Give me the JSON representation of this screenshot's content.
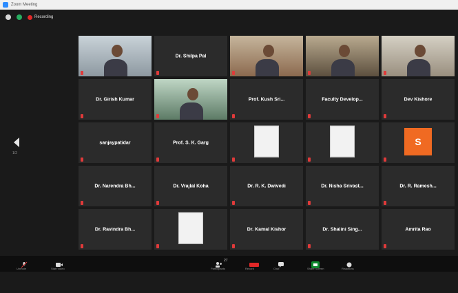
{
  "window": {
    "title": "Zoom Meeting"
  },
  "top_bar": {
    "recording_label": "Recording"
  },
  "side_nav": {
    "page_label": "1/2"
  },
  "participants": [
    {
      "type": "video",
      "name": "",
      "label": ""
    },
    {
      "type": "name",
      "name": "Dr. Shilpa Pal",
      "label": ""
    },
    {
      "type": "video",
      "name": "",
      "label": ""
    },
    {
      "type": "video",
      "name": "",
      "label": ""
    },
    {
      "type": "video",
      "name": "",
      "label": ""
    },
    {
      "type": "name",
      "name": "Dr. Girish Kumar",
      "label": ""
    },
    {
      "type": "video",
      "name": "",
      "label": "",
      "active": true
    },
    {
      "type": "name",
      "name": "Prof. Kush Sri...",
      "label": ""
    },
    {
      "type": "name",
      "name": "Faculty Develop...",
      "label": ""
    },
    {
      "type": "name",
      "name": "Dev Kishore",
      "label": ""
    },
    {
      "type": "name",
      "name": "sanjaypatidar",
      "label": ""
    },
    {
      "type": "name",
      "name": "Prof. S. K. Garg",
      "label": ""
    },
    {
      "type": "picture",
      "name": "",
      "label": ""
    },
    {
      "type": "picture",
      "name": "",
      "label": ""
    },
    {
      "type": "avatar",
      "name": "",
      "label": "",
      "avatar_letter": "S"
    },
    {
      "type": "name",
      "name": "Dr. Narendra Bh...",
      "label": ""
    },
    {
      "type": "name",
      "name": "Dr. Vrajlal Koha",
      "label": ""
    },
    {
      "type": "name",
      "name": "Dr. R. K. Dwivedi",
      "label": ""
    },
    {
      "type": "name",
      "name": "Dr. Nisha Srivast...",
      "label": ""
    },
    {
      "type": "name",
      "name": "Dr. R. Ramesh...",
      "label": ""
    },
    {
      "type": "name",
      "name": "Dr. Ravindra Bh...",
      "label": ""
    },
    {
      "type": "picture",
      "name": "",
      "label": ""
    },
    {
      "type": "name",
      "name": "Dr. Kamal Kishor",
      "label": ""
    },
    {
      "type": "name",
      "name": "Dr. Shalini Sing...",
      "label": ""
    },
    {
      "type": "name",
      "name": "Amrita Rao",
      "label": ""
    }
  ],
  "toolbar": {
    "unmute": "Unmute",
    "video": "Start Video",
    "participants": "Participants",
    "participant_count": "27",
    "chat": "Chat",
    "share": "Share Screen",
    "record": "Record",
    "reactions": "Reactions"
  },
  "colors": {
    "accent_active": "#9acd32",
    "avatar_bg": "#f06a22",
    "record_red": "#e02828",
    "share_green": "#0e8a2e"
  }
}
